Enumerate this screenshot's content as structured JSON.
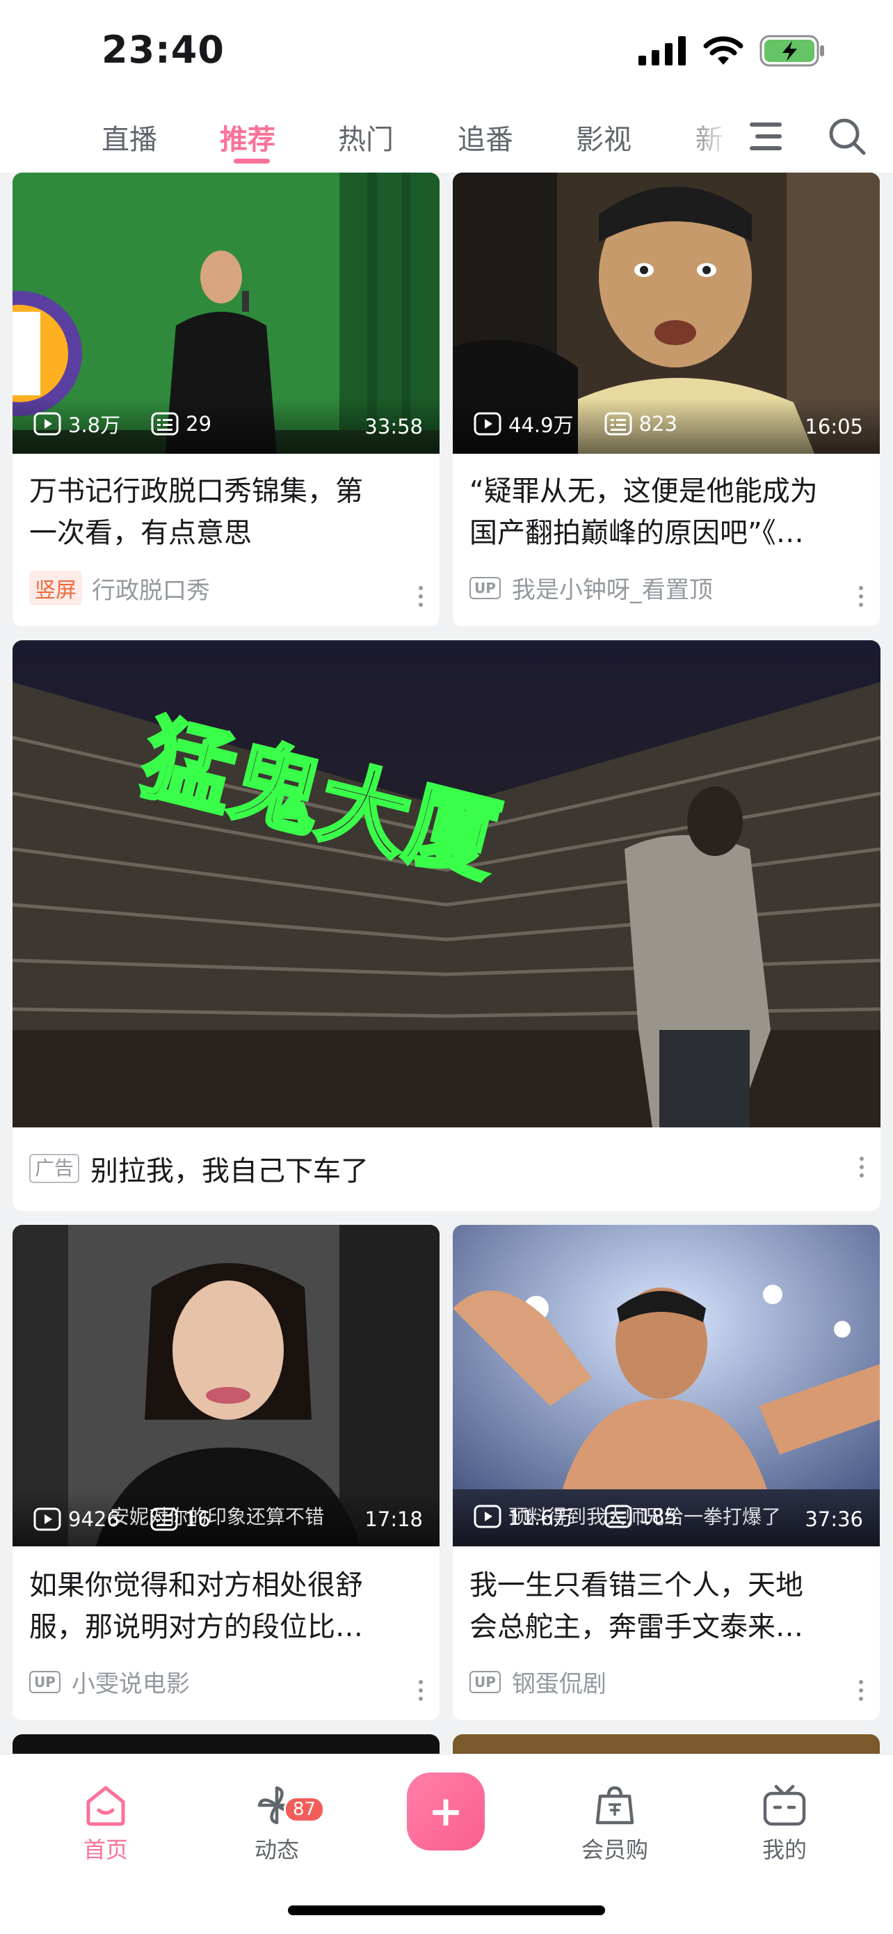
{
  "status_bar": {
    "time": "23:40"
  },
  "colors": {
    "accent": "#fb7299",
    "badge_red": "#f25d59",
    "battery_green": "#65c466"
  },
  "top_nav": {
    "tabs": [
      "直播",
      "推荐",
      "热门",
      "追番",
      "影视",
      "新"
    ],
    "active_tab": "推荐",
    "icons": [
      "menu-icon",
      "search-icon"
    ]
  },
  "feed": {
    "card1": {
      "views": "3.8万",
      "danmaku": "29",
      "duration": "33:58",
      "title_line1": "万书记行政脱口秀锦集，第",
      "title_line2": "一次看，有点意思",
      "badge": "竖屏",
      "author": "行政脱口秀"
    },
    "card2": {
      "views": "44.9万",
      "danmaku": "823",
      "duration": "16:05",
      "title_line1": "“疑罪从无，这便是他能成为",
      "title_line2": "国产翻拍巅峰的原因吧”《…",
      "badge": "UP",
      "author": "我是小钟呀_看置顶"
    },
    "ad": {
      "image_text": "猛鬼大厦",
      "badge": "广告",
      "title": "别拉我，我自己下车了"
    },
    "card3": {
      "views": "9426",
      "danmaku": "16",
      "duration": "17:18",
      "subtitle_overlay": "安妮对你的印象还算不错",
      "title_line1": "如果你觉得和对方相处很舒",
      "title_line2": "服，那说明对方的段位比…",
      "badge": "UP",
      "author": "小雯说电影"
    },
    "card4": {
      "views": "11.6万",
      "danmaku": "185",
      "duration": "37:36",
      "subtitle_overlay": "预料得到我大师兄给一拳打爆了",
      "title_line1": "我一生只看错三个人，天地",
      "title_line2": "会总舵主，奔雷手文泰来…",
      "badge": "UP",
      "author": "钢蛋侃剧"
    }
  },
  "bottom_nav": {
    "home": "首页",
    "dynamic": "动态",
    "dynamic_badge": "87",
    "plus": "+",
    "shop": "会员购",
    "mine": "我的"
  }
}
